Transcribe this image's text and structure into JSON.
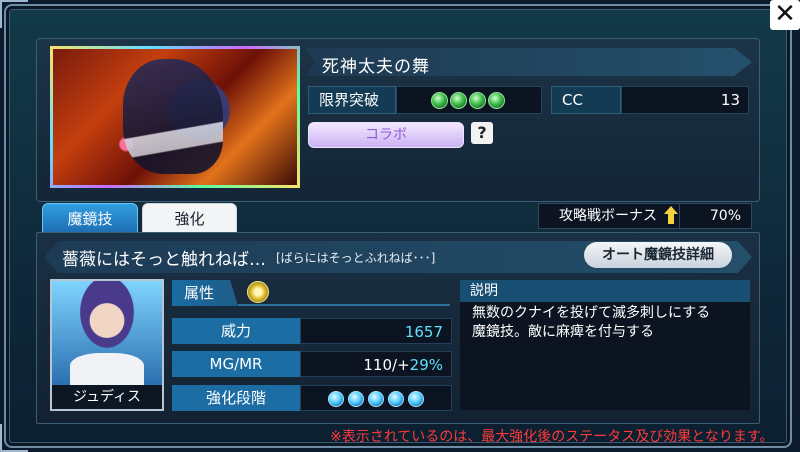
{
  "close": {
    "label": "✕"
  },
  "card": {
    "title": "死神太夫の舞",
    "limit_break": {
      "label": "限界突破",
      "filled": 4
    },
    "cc": {
      "label": "CC",
      "value": "13"
    },
    "badge": "コラボ",
    "help": "?"
  },
  "tabs": [
    {
      "label": "魔鏡技",
      "active": true
    },
    {
      "label": "強化",
      "active": false
    }
  ],
  "bonus": {
    "label": "攻略戦ボーナス",
    "value": "70%"
  },
  "ability": {
    "name": "薔薇にはそっと触れねば…",
    "reading": "[ばらにはそっとふれねば･･･]",
    "detail_button": "オート魔鏡技詳細"
  },
  "character": {
    "name": "ジュディス"
  },
  "stats": {
    "attribute_label": "属性",
    "power_label": "威力",
    "power_value": "1657",
    "mgmr_label": "MG/MR",
    "mgmr_value_base": "110/+",
    "mgmr_value_pct": "29%",
    "stage_label": "強化段階",
    "stage_count": 5
  },
  "description": {
    "header": "説明",
    "text": "無数のクナイを投げて滅多刺しにする\n魔鏡技。敵に麻痺を付与する"
  },
  "footer_note": "※表示されているのは、最大強化後のステータス及び効果となります。",
  "colors": {
    "accent_blue": "#1b6da3",
    "power_value": "#5fe1ff",
    "note_red": "#ff3a3a",
    "gem_green": "#3fbf4a"
  }
}
